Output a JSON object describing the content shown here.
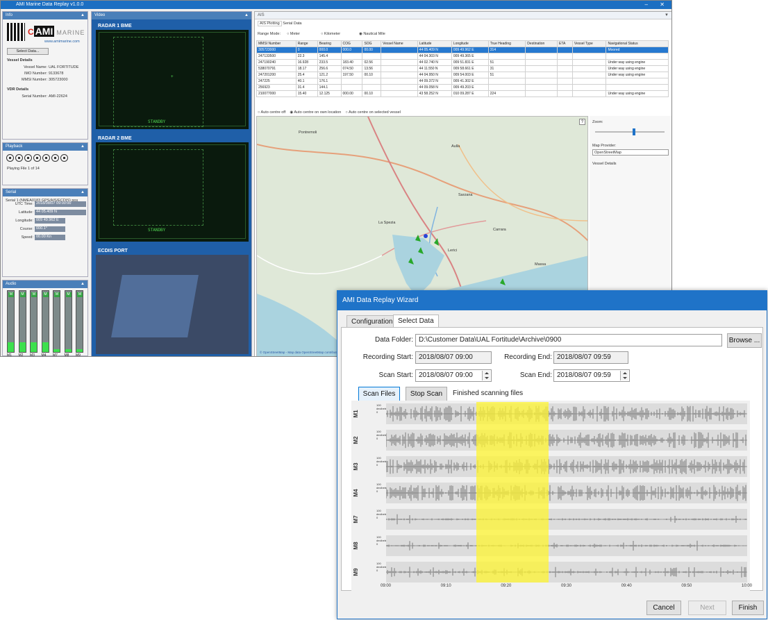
{
  "app": {
    "title": "AMI Marine Data Replay v1.0.0",
    "info_panel": {
      "header": "Info",
      "brand": "AMI",
      "brand_suffix": "MARINE",
      "website": "www.amimarine.com",
      "select_data_label": "Select Data...",
      "vessel_details_title": "Vessel Details",
      "vessel_name_label": "Vessel Name:",
      "vessel_name": "UAL FORTITUDE",
      "imo_label": "IMO Number:",
      "imo": "9133678",
      "mmsi_label": "MMSI Number:",
      "mmsi": "305723000",
      "vdr_title": "VDR Details",
      "serial_label": "Serial Number:",
      "serial": "AMI-22624"
    },
    "playback_panel": {
      "header": "Playback",
      "status": "Playing File 1 of 14"
    },
    "serial_panel": {
      "header": "Serial",
      "source": "Serial 1 (NMEA0183 GPS/AIS/ECDIS) pos",
      "fields": [
        {
          "label": "UTC Time:",
          "value": "2018/08/07 09:00:00"
        },
        {
          "label": "Latitude:",
          "value": "44 05.409 N"
        },
        {
          "label": "Longitude:",
          "value": "009 49.962 E"
        },
        {
          "label": "Course:",
          "value": "000.1°"
        },
        {
          "label": "Speed:",
          "value": "00.00 Kn"
        }
      ]
    },
    "audio_panel": {
      "header": "Audio",
      "channels": [
        "M1",
        "M2",
        "M3",
        "M4",
        "M7",
        "M8",
        "M9"
      ],
      "meter_tag": "M"
    },
    "video_panel": {
      "header": "Video"
    },
    "radars": [
      {
        "title": "RADAR 1 BME",
        "standby": "STANDBY"
      },
      {
        "title": "RADAR 2 BME",
        "standby": "STANDBY"
      },
      {
        "title": "ECDIS PORT"
      }
    ],
    "ais": {
      "header": "AIS",
      "tabs": [
        "AIS Plotting",
        "Serial Data"
      ],
      "range_mode_label": "Range Mode:",
      "range_options": [
        "Meter",
        "Kilometer",
        "Nautical Mile"
      ],
      "columns": [
        "MMSI Number",
        "Range",
        "Bearing",
        "COG",
        "SOG",
        "Vessel Name",
        "Latitude",
        "Longitude",
        "True Heading",
        "Destination",
        "ETA",
        "Vessel Type",
        "Navigational Status"
      ],
      "rows": [
        [
          "305723000",
          "0",
          "000.0",
          "000.0",
          "00.00",
          "",
          "44 05.409 N",
          "009 49.962 E",
          "314",
          "",
          "",
          "",
          "Moored"
        ],
        [
          "247133500",
          "22.3",
          "145.4",
          "",
          "",
          "",
          "44 04.303 N",
          "009 49.365 E",
          "",
          "",
          "",
          "",
          ""
        ],
        [
          "247190240",
          "16.928",
          "233.5",
          "183.40",
          "02.56",
          "",
          "44 02.740 N",
          "009 51.831 E",
          "51",
          "",
          "",
          "",
          "Under way using engine"
        ],
        [
          "538070791",
          "18.17",
          "256.6",
          "074.50",
          "13.56",
          "",
          "44 11.550 N",
          "009 58.661 E",
          "31",
          "",
          "",
          "",
          "Under way using engine"
        ],
        [
          "247201200",
          "25.4",
          "121.2",
          "197.50",
          "00.10",
          "",
          "44 04.950 N",
          "009 54.003 E",
          "51",
          "",
          "",
          "",
          "Under way using engine"
        ],
        [
          "247225",
          "40.1",
          "176.1",
          "",
          "",
          "",
          "44 09.372 N",
          "009 41.302 E",
          "",
          "",
          "",
          "",
          ""
        ],
        [
          "256923",
          "31.4",
          "144.1",
          "",
          "",
          "",
          "44 09.058 N",
          "009 49.203 E",
          "",
          "",
          "",
          "",
          ""
        ],
        [
          "210077000",
          "15.40",
          "12.125",
          "000.00",
          "00.10",
          "",
          "43 58.252 N",
          "010 09.287 E",
          "224",
          "",
          "",
          "",
          "Under way using engine"
        ]
      ],
      "centre_options": [
        "Auto centre off",
        "Auto centre on own location",
        "Auto centre on selected vessel"
      ],
      "zoom_label": "Zoom:",
      "map_provider_label": "Map Provider:",
      "map_provider": "OpenStreetMap",
      "vessel_details_label": "Vessel Details",
      "map_attribution": "© OpenStreetMap - Map data OpenStreetMap contributors",
      "map_places": [
        "Aulla",
        "Sarzana",
        "La Spezia",
        "Lerici",
        "Carrara",
        "Massa",
        "Pontremoli"
      ]
    }
  },
  "wizard": {
    "title": "AMI Data Replay Wizard",
    "tabs": [
      "Configuration",
      "Select Data"
    ],
    "data_folder_label": "Data Folder:",
    "data_folder": "D:\\Customer Data\\UAL Fortitude\\Archive\\0900",
    "browse_label": "Browse ...",
    "recording_start_label": "Recording Start:",
    "recording_start": "2018/08/07 09:00",
    "recording_end_label": "Recording End:",
    "recording_end": "2018/08/07 09:59",
    "scan_start_label": "Scan Start:",
    "scan_start": "2018/08/07 09:00",
    "scan_end_label": "Scan End:",
    "scan_end": "2018/08/07 09:59",
    "scan_files_label": "Scan Files",
    "stop_scan_label": "Stop Scan",
    "scan_status": "Finished scanning files",
    "scale_top": "100",
    "scale_unit": "decibels",
    "scale_bottom": "0",
    "tracks": [
      {
        "name": "M1",
        "activity": 0.9
      },
      {
        "name": "M2",
        "activity": 0.9
      },
      {
        "name": "M3",
        "activity": 0.85
      },
      {
        "name": "M4",
        "activity": 0.9
      },
      {
        "name": "M7",
        "activity": 0.15
      },
      {
        "name": "M8",
        "activity": 0.15
      },
      {
        "name": "M9",
        "activity": 0.5
      }
    ],
    "x_ticks": [
      "09:00",
      "09:10",
      "09:20",
      "09:30",
      "09:40",
      "09:50",
      "10:00"
    ],
    "highlight": {
      "start": "09:15",
      "end": "09:27"
    },
    "cancel_label": "Cancel",
    "next_label": "Next",
    "finish_label": "Finish",
    "colors": {
      "accent": "#1f73c8",
      "highlight": "#fff532",
      "wave": "#7a7a7a"
    }
  }
}
